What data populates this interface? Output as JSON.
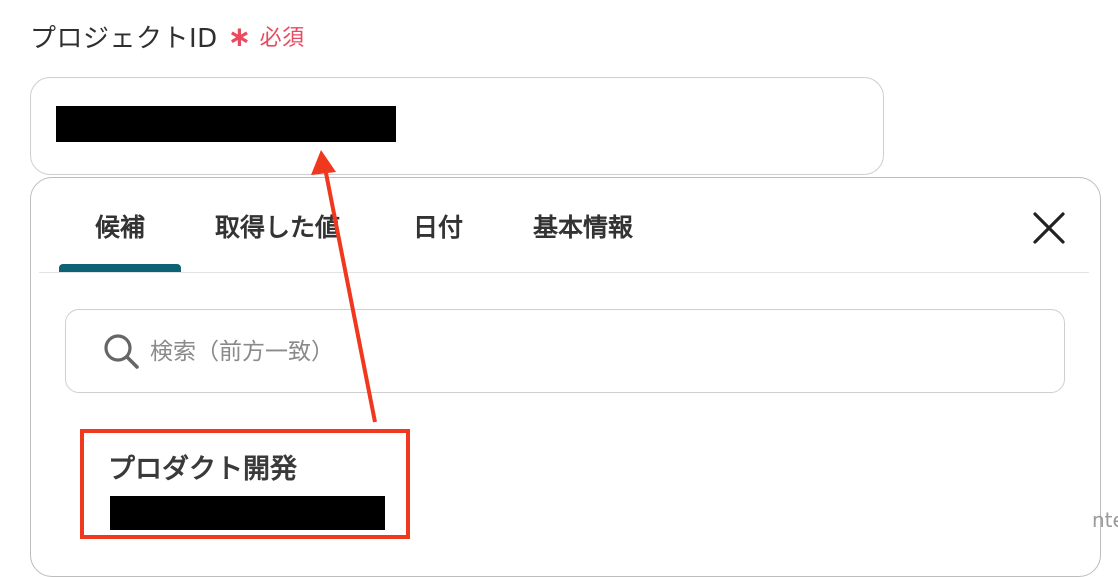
{
  "field": {
    "label": "プロジェクトID",
    "required_star": "∗",
    "required_text": "必須"
  },
  "tabs": [
    {
      "label": "候補",
      "active": true
    },
    {
      "label": "取得した値",
      "active": false
    },
    {
      "label": "日付",
      "active": false
    },
    {
      "label": "基本情報",
      "active": false
    }
  ],
  "search": {
    "placeholder": "検索（前方一致）"
  },
  "results": [
    {
      "title": "プロダクト開発"
    }
  ],
  "edge_text": "nte",
  "colors": {
    "required": "#e84a5f",
    "tab_active_underline": "#0e6275",
    "annotation": "#f0381e"
  },
  "icons": {
    "close": "close-icon",
    "search": "search-icon"
  }
}
